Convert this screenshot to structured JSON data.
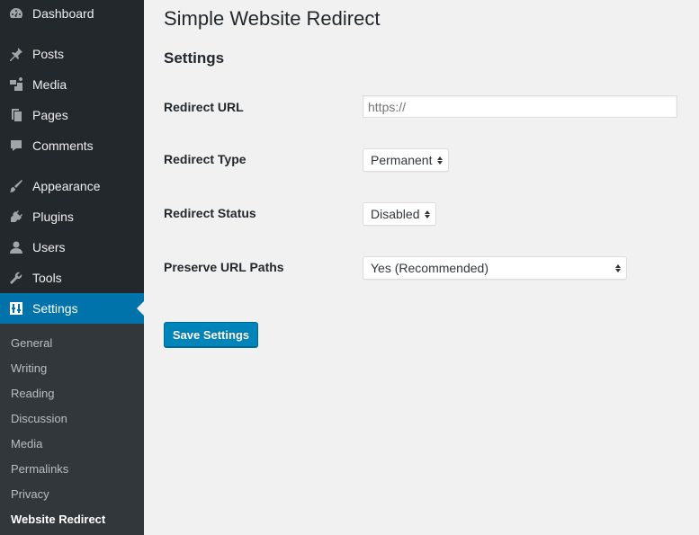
{
  "sidebar": {
    "items": [
      {
        "label": "Dashboard",
        "icon": "dashboard-icon"
      },
      {
        "label": "Posts",
        "icon": "pin-icon"
      },
      {
        "label": "Media",
        "icon": "media-icon"
      },
      {
        "label": "Pages",
        "icon": "pages-icon"
      },
      {
        "label": "Comments",
        "icon": "comment-icon"
      },
      {
        "label": "Appearance",
        "icon": "brush-icon"
      },
      {
        "label": "Plugins",
        "icon": "plug-icon"
      },
      {
        "label": "Users",
        "icon": "user-icon"
      },
      {
        "label": "Tools",
        "icon": "wrench-icon"
      },
      {
        "label": "Settings",
        "icon": "settings-icon"
      }
    ],
    "submenu": [
      {
        "label": "General"
      },
      {
        "label": "Writing"
      },
      {
        "label": "Reading"
      },
      {
        "label": "Discussion"
      },
      {
        "label": "Media"
      },
      {
        "label": "Permalinks"
      },
      {
        "label": "Privacy"
      },
      {
        "label": "Website Redirect"
      }
    ],
    "current_item": "Settings",
    "current_subitem": "Website Redirect"
  },
  "page": {
    "title": "Simple Website Redirect",
    "section_title": "Settings"
  },
  "form": {
    "redirect_url": {
      "label": "Redirect URL",
      "placeholder": "https://",
      "value": ""
    },
    "redirect_type": {
      "label": "Redirect Type",
      "value": "Permanent"
    },
    "redirect_status": {
      "label": "Redirect Status",
      "value": "Disabled"
    },
    "preserve_paths": {
      "label": "Preserve URL Paths",
      "value": "Yes (Recommended)"
    },
    "save_label": "Save Settings"
  },
  "colors": {
    "sidebar_bg": "#23282d",
    "submenu_bg": "#32373c",
    "accent": "#0073aa",
    "button": "#0085ba",
    "page_bg": "#f1f1f1"
  }
}
